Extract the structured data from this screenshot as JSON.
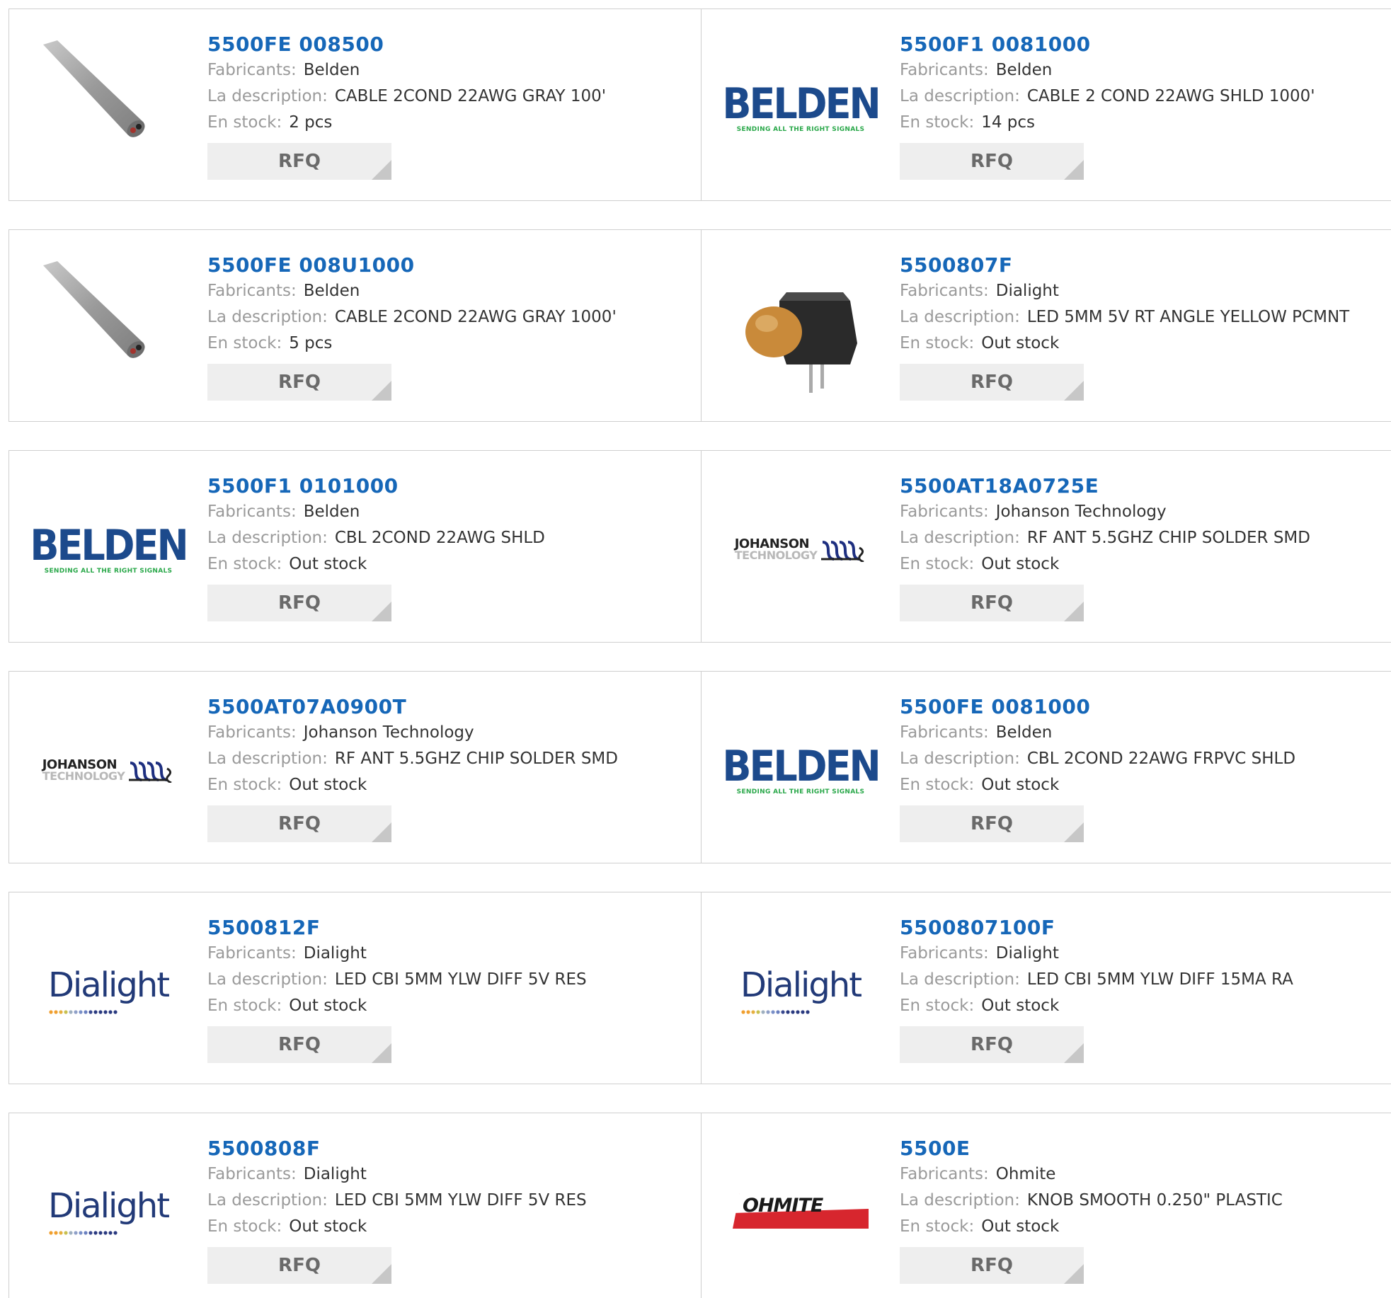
{
  "labels": {
    "manufacturer": "Fabricants:",
    "description": "La description:",
    "stock": "En stock:",
    "rfq": "RFQ"
  },
  "logos": {
    "belden_word": "BELDEN",
    "belden_tagline": "SENDING ALL THE RIGHT SIGNALS",
    "johanson_line1": "JOHANSON",
    "johanson_line2": "TECHNOLOGY",
    "dialight_word": "Dialight",
    "ohmite_word": "OHMITE"
  },
  "colors": {
    "link": "#1667b8",
    "belden_blue": "#1c4a8c",
    "belden_green": "#2aa84a",
    "ohmite_red": "#d7262e"
  },
  "products": [
    {
      "part": "5500FE 008500",
      "manufacturer": "Belden",
      "description": "CABLE 2COND 22AWG GRAY 100'",
      "stock": "2 pcs",
      "image": "gray-cable-photo"
    },
    {
      "part": "5500F1 0081000",
      "manufacturer": "Belden",
      "description": "CABLE 2 COND 22AWG SHLD 1000'",
      "stock": "14 pcs",
      "image": "belden-logo"
    },
    {
      "part": "5500FE 008U1000",
      "manufacturer": "Belden",
      "description": "CABLE 2COND 22AWG GRAY 1000'",
      "stock": "5 pcs",
      "image": "gray-cable-photo"
    },
    {
      "part": "5500807F",
      "manufacturer": "Dialight",
      "description": "LED 5MM 5V RT ANGLE YELLOW PCMNT",
      "stock": "Out stock",
      "image": "led-photo"
    },
    {
      "part": "5500F1 0101000",
      "manufacturer": "Belden",
      "description": "CBL 2COND 22AWG SHLD",
      "stock": "Out stock",
      "image": "belden-logo"
    },
    {
      "part": "5500AT18A0725E",
      "manufacturer": "Johanson Technology",
      "description": "RF ANT 5.5GHZ CHIP SOLDER SMD",
      "stock": "Out stock",
      "image": "johanson-logo"
    },
    {
      "part": "5500AT07A0900T",
      "manufacturer": "Johanson Technology",
      "description": "RF ANT 5.5GHZ CHIP SOLDER SMD",
      "stock": "Out stock",
      "image": "johanson-logo"
    },
    {
      "part": "5500FE 0081000",
      "manufacturer": "Belden",
      "description": "CBL 2COND 22AWG FRPVC SHLD",
      "stock": "Out stock",
      "image": "belden-logo"
    },
    {
      "part": "5500812F",
      "manufacturer": "Dialight",
      "description": "LED CBI 5MM YLW DIFF 5V RES",
      "stock": "Out stock",
      "image": "dialight-logo"
    },
    {
      "part": "5500807100F",
      "manufacturer": "Dialight",
      "description": "LED CBI 5MM YLW DIFF 15MA RA",
      "stock": "Out stock",
      "image": "dialight-logo"
    },
    {
      "part": "5500808F",
      "manufacturer": "Dialight",
      "description": "LED CBI 5MM YLW DIFF 5V RES",
      "stock": "Out stock",
      "image": "dialight-logo"
    },
    {
      "part": "5500E",
      "manufacturer": "Ohmite",
      "description": "KNOB SMOOTH 0.250\" PLASTIC",
      "stock": "Out stock",
      "image": "ohmite-logo"
    }
  ]
}
